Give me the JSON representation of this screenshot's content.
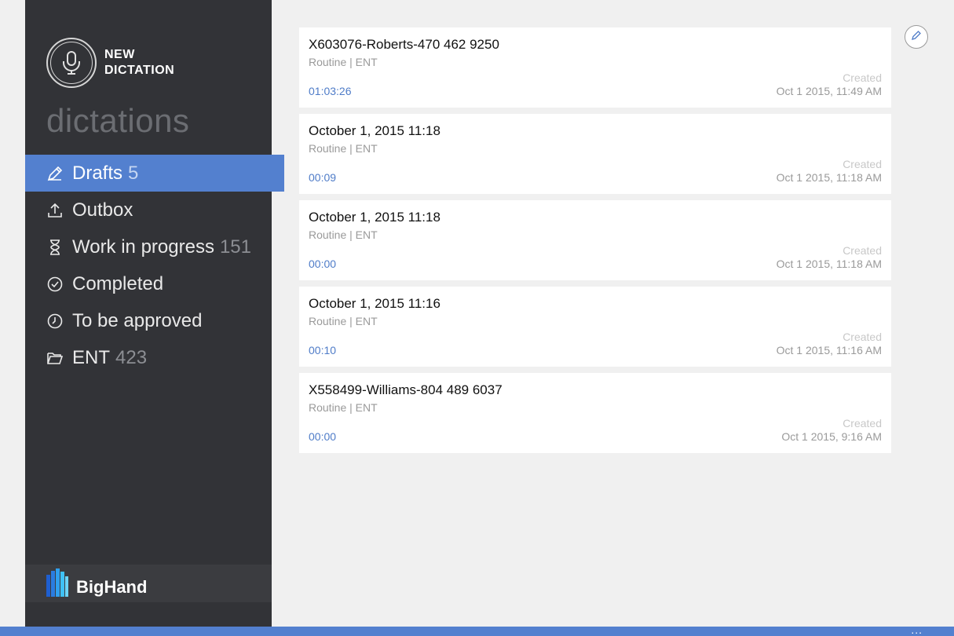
{
  "sidebar": {
    "new_dictation": {
      "label": "NEW DICTATION",
      "icon": "microphone-icon"
    },
    "section_title": "dictations",
    "items": [
      {
        "label": "Drafts",
        "count": "5",
        "icon": "pencil-icon",
        "active": true
      },
      {
        "label": "Outbox",
        "count": "",
        "icon": "upload-icon",
        "active": false
      },
      {
        "label": "Work in progress",
        "count": "151",
        "icon": "hourglass-icon",
        "active": false
      },
      {
        "label": "Completed",
        "count": "",
        "icon": "check-circle-icon",
        "active": false
      },
      {
        "label": "To be approved",
        "count": "",
        "icon": "clock-icon",
        "active": false
      },
      {
        "label": "ENT",
        "count": "423",
        "icon": "folder-icon",
        "active": false
      }
    ],
    "brand": {
      "name": "BigHand",
      "icon": "bighand-logo"
    }
  },
  "dictations": [
    {
      "title": "X603076-Roberts-470 462 9250",
      "subtitle": "Routine | ENT",
      "duration": "01:03:26",
      "created_label": "Created",
      "created": "Oct 1 2015, 11:49 AM"
    },
    {
      "title": "October 1, 2015 11:18",
      "subtitle": "Routine | ENT",
      "duration": "00:09",
      "created_label": "Created",
      "created": "Oct 1 2015, 11:18 AM"
    },
    {
      "title": "October 1, 2015 11:18",
      "subtitle": "Routine | ENT",
      "duration": "00:00",
      "created_label": "Created",
      "created": "Oct 1 2015, 11:18 AM"
    },
    {
      "title": "October 1, 2015 11:16",
      "subtitle": "Routine | ENT",
      "duration": "00:10",
      "created_label": "Created",
      "created": "Oct 1 2015, 11:16 AM"
    },
    {
      "title": "X558499-Williams-804 489 6037",
      "subtitle": "Routine | ENT",
      "duration": "00:00",
      "created_label": "Created",
      "created": "Oct 1 2015, 9:16 AM"
    }
  ],
  "toolbar": {
    "edit_icon": "edit-icon",
    "more_label": "..."
  },
  "colors": {
    "accent": "#5380cf",
    "sidebar_bg": "#323337",
    "duration": "#4f7cc8"
  }
}
